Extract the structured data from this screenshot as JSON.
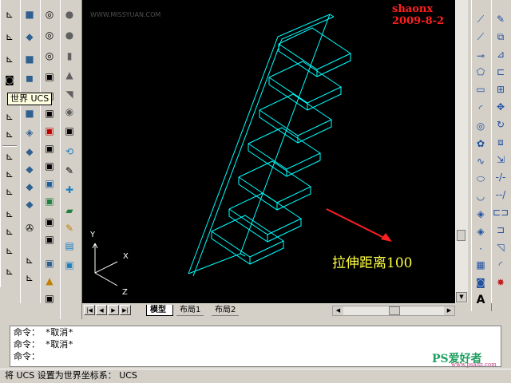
{
  "left_toolbar_1": {
    "icons": [
      "ucs-icon",
      "ucs-world-icon",
      "ucs-previous-icon",
      "ucs-origin-icon",
      "ucs-zaxis-icon",
      "ucs-3point-icon",
      "ucs-object-icon",
      "ucs-face-icon",
      "ucs-view-icon",
      "ucs-x-icon",
      "ucs-y-icon",
      "ucs-z-icon",
      "ucs-apply-icon",
      "ucs-named-icon",
      "ucs-orthographic-icon",
      "ucs-manager-icon",
      "ucs-setting-icon"
    ]
  },
  "tooltip": {
    "text": "世界 UCS"
  },
  "canvas": {
    "watermark": "shaonx 2009-8-2",
    "site_watermark": "WWW.MISSYUAN.COM",
    "annotation": "拉伸距离100",
    "axis_x": "X",
    "axis_y": "Y",
    "axis_z": "Z",
    "stroke_color": "#00ffff",
    "annotation_color": "#ffff00",
    "watermark_color": "#ff0000"
  },
  "tabs": {
    "model": "模型",
    "layout1": "布局1",
    "layout2": "布局2"
  },
  "command": {
    "lines": [
      "命令： *取消*",
      "命令： *取消*",
      "命令："
    ]
  },
  "status": {
    "text": "将 UCS 设置为世界坐标系： UCS"
  },
  "logo": {
    "text": "PS爱好者",
    "sub": "www.psahz.com"
  }
}
